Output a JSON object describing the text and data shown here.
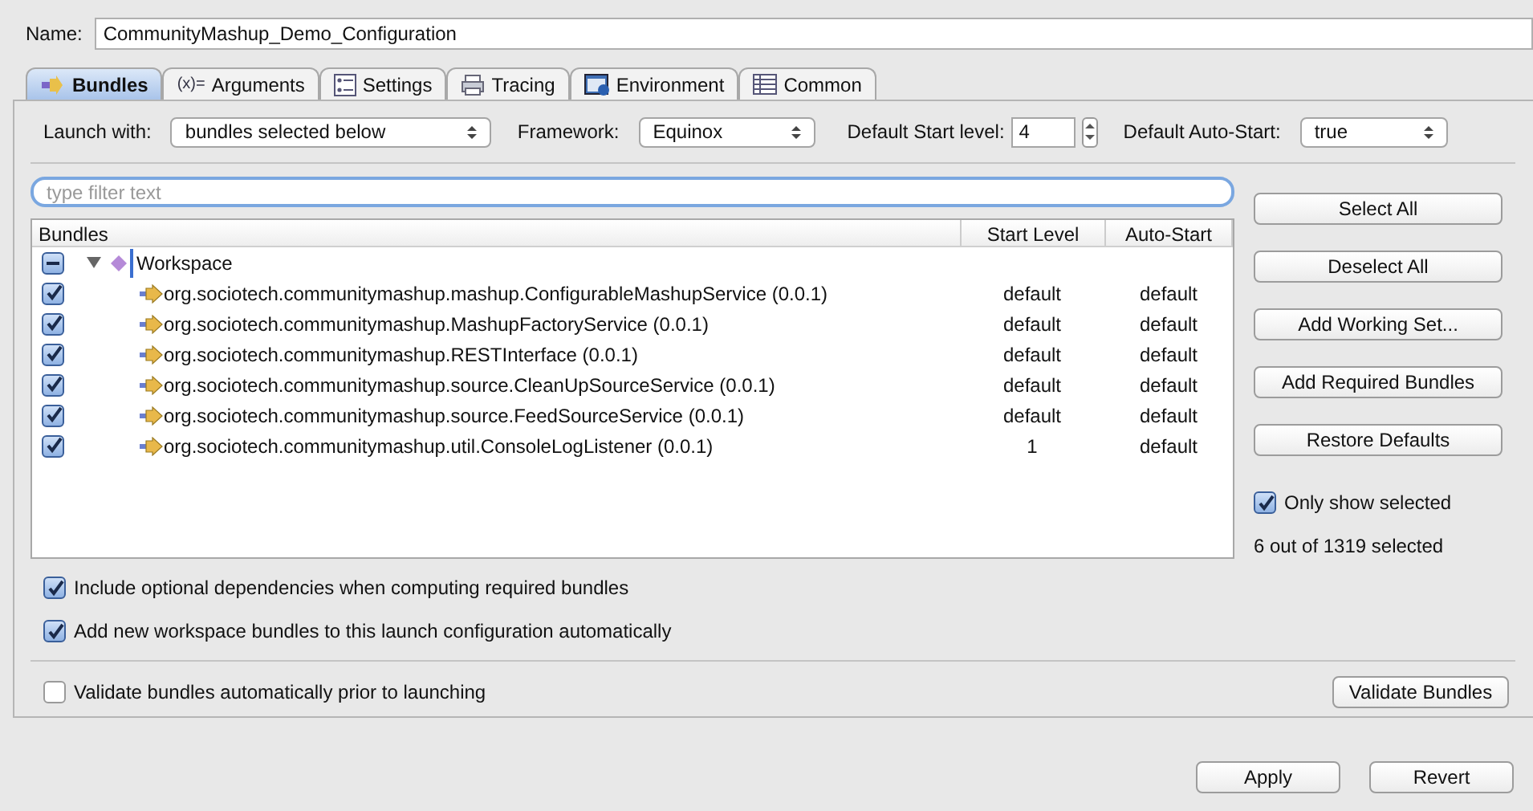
{
  "name_field": {
    "label": "Name:",
    "value": "CommunityMashup_Demo_Configuration"
  },
  "tabs": [
    {
      "label": "Bundles",
      "selected": true,
      "kind": "bundles"
    },
    {
      "label": "Arguments",
      "selected": false,
      "kind": "arguments",
      "icon": "(x)="
    },
    {
      "label": "Settings",
      "selected": false,
      "kind": "settings"
    },
    {
      "label": "Tracing",
      "selected": false,
      "kind": "tracing"
    },
    {
      "label": "Environment",
      "selected": false,
      "kind": "environment"
    },
    {
      "label": "Common",
      "selected": false,
      "kind": "common"
    }
  ],
  "launch": {
    "launch_with_label": "Launch with:",
    "launch_with": "bundles selected below",
    "framework_label": "Framework:",
    "framework": "Equinox",
    "start_level_label": "Default Start level:",
    "start_level": "4",
    "auto_start_label": "Default Auto-Start:",
    "auto_start": "true"
  },
  "filter": {
    "placeholder": "type filter text"
  },
  "table": {
    "columns": [
      "Bundles",
      "Start Level",
      "Auto-Start"
    ],
    "group": {
      "label": "Workspace",
      "partial": true,
      "expanded": true,
      "children": [
        {
          "name": "org.sociotech.communitymashup.mashup.ConfigurableMashupService (0.0.1)",
          "start_level": "default",
          "auto_start": "default",
          "checked": true
        },
        {
          "name": "org.sociotech.communitymashup.MashupFactoryService (0.0.1)",
          "start_level": "default",
          "auto_start": "default",
          "checked": true
        },
        {
          "name": "org.sociotech.communitymashup.RESTInterface (0.0.1)",
          "start_level": "default",
          "auto_start": "default",
          "checked": true
        },
        {
          "name": "org.sociotech.communitymashup.source.CleanUpSourceService (0.0.1)",
          "start_level": "default",
          "auto_start": "default",
          "checked": true
        },
        {
          "name": "org.sociotech.communitymashup.source.FeedSourceService (0.0.1)",
          "start_level": "default",
          "auto_start": "default",
          "checked": true
        },
        {
          "name": "org.sociotech.communitymashup.util.ConsoleLogListener (0.0.1)",
          "start_level": "1",
          "auto_start": "default",
          "checked": true
        }
      ]
    }
  },
  "side_buttons": [
    "Select All",
    "Deselect All",
    "Add Working Set...",
    "Add Required Bundles",
    "Restore Defaults"
  ],
  "only_show_selected": {
    "label": "Only show selected",
    "checked": true
  },
  "selection_count": "6 out of 1319 selected",
  "options": [
    {
      "label": "Include optional dependencies when computing required bundles",
      "checked": true
    },
    {
      "label": "Add new workspace bundles to this launch configuration automatically",
      "checked": true
    }
  ],
  "validate": {
    "label": "Validate bundles automatically prior to launching",
    "checked": false,
    "button": "Validate Bundles"
  },
  "buttons": [
    "Apply",
    "Revert"
  ]
}
